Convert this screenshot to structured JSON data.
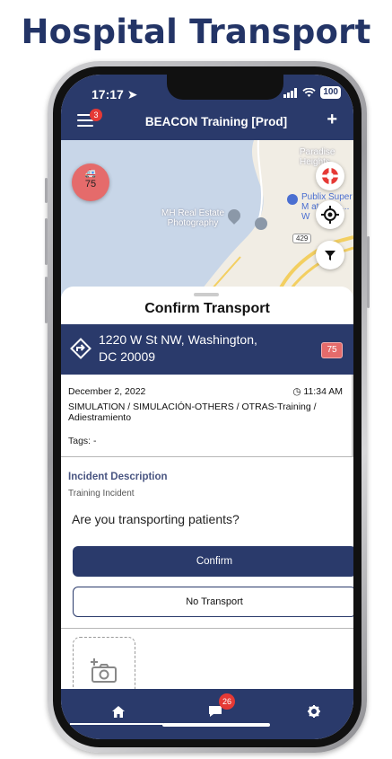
{
  "heading": "Hospital Transport",
  "status_bar": {
    "time": "17:17",
    "battery": "100"
  },
  "app_bar": {
    "title": "BEACON Training [Prod]",
    "menu_badge": "3"
  },
  "map": {
    "labels": {
      "area": "Paradise Heights",
      "poi_1": "MH Real Estate Photography",
      "poi_2": "Publix Super M at Foun... W",
      "road": "429"
    },
    "unit_counter": "75"
  },
  "sheet": {
    "title": "Confirm Transport",
    "address_line1": "1220 W St NW, Washington,",
    "address_line2": "DC 20009",
    "address_badge": "75",
    "date": "December 2, 2022",
    "time": "11:34 AM",
    "category": "SIMULATION / SIMULACIÓN-OTHERS / OTRAS-Training / Adiestramiento",
    "tags": "Tags: -",
    "incident_heading": "Incident Description",
    "incident_value": "Training Incident",
    "question": "Are you transporting patients?",
    "confirm_label": "Confirm",
    "no_transport_label": "No Transport"
  },
  "tabbar": {
    "messages_badge": "26"
  },
  "colors": {
    "primary": "#2a3a6b",
    "danger": "#e56b6b",
    "badge": "#e53935",
    "heading": "#233466"
  }
}
